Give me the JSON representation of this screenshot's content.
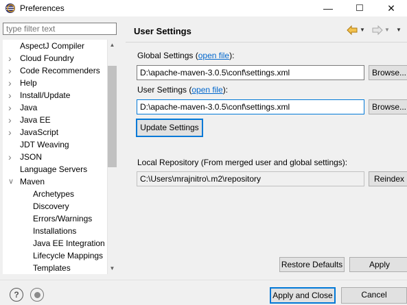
{
  "window": {
    "title": "Preferences",
    "minimize": "—",
    "maximize": "☐",
    "close": "✕"
  },
  "filter": {
    "placeholder": "type filter text"
  },
  "tree": {
    "items": [
      {
        "label": "AspectJ Compiler",
        "arrow": ""
      },
      {
        "label": "Cloud Foundry",
        "arrow": ">"
      },
      {
        "label": "Code Recommenders",
        "arrow": ">"
      },
      {
        "label": "Help",
        "arrow": ">"
      },
      {
        "label": "Install/Update",
        "arrow": ">"
      },
      {
        "label": "Java",
        "arrow": ">"
      },
      {
        "label": "Java EE",
        "arrow": ">"
      },
      {
        "label": "JavaScript",
        "arrow": ">"
      },
      {
        "label": "JDT Weaving",
        "arrow": ""
      },
      {
        "label": "JSON",
        "arrow": ">"
      },
      {
        "label": "Language Servers",
        "arrow": ""
      },
      {
        "label": "Maven",
        "arrow": "v"
      },
      {
        "label": "Archetypes",
        "arrow": ""
      },
      {
        "label": "Discovery",
        "arrow": ""
      },
      {
        "label": "Errors/Warnings",
        "arrow": ""
      },
      {
        "label": "Installations",
        "arrow": ""
      },
      {
        "label": "Java EE Integration",
        "arrow": ""
      },
      {
        "label": "Lifecycle Mappings",
        "arrow": ""
      },
      {
        "label": "Templates",
        "arrow": ""
      }
    ]
  },
  "pane": {
    "title": "User Settings",
    "global_label": "Global Settings (",
    "global_label_accel": "S",
    "global_link": "open file",
    "global_label_end": "):",
    "global_value": "D:\\apache-maven-3.0.5\\conf\\settings.xml",
    "browse1": "Browse...",
    "user_label": "User Settings (",
    "user_link": "open file",
    "user_label_end": "):",
    "user_value": "D:\\apache-maven-3.0.5\\conf\\settings.xml",
    "browse2": "Browse...",
    "update_btn": "Update Settings",
    "local_repo_label": "Local Repository (From merged user and global settings):",
    "local_repo_value": "C:\\Users\\mrajnitro\\.m2\\repository",
    "reindex_btn": "Reindex",
    "restore_defaults": "Restore Defaults",
    "apply": "Apply"
  },
  "footer": {
    "help_glyph": "?",
    "apply_close": "Apply and Close",
    "cancel": "Cancel"
  },
  "colors": {
    "accent": "#0078d7",
    "link": "#0066cc",
    "nav_arrow": "#e8a317"
  }
}
